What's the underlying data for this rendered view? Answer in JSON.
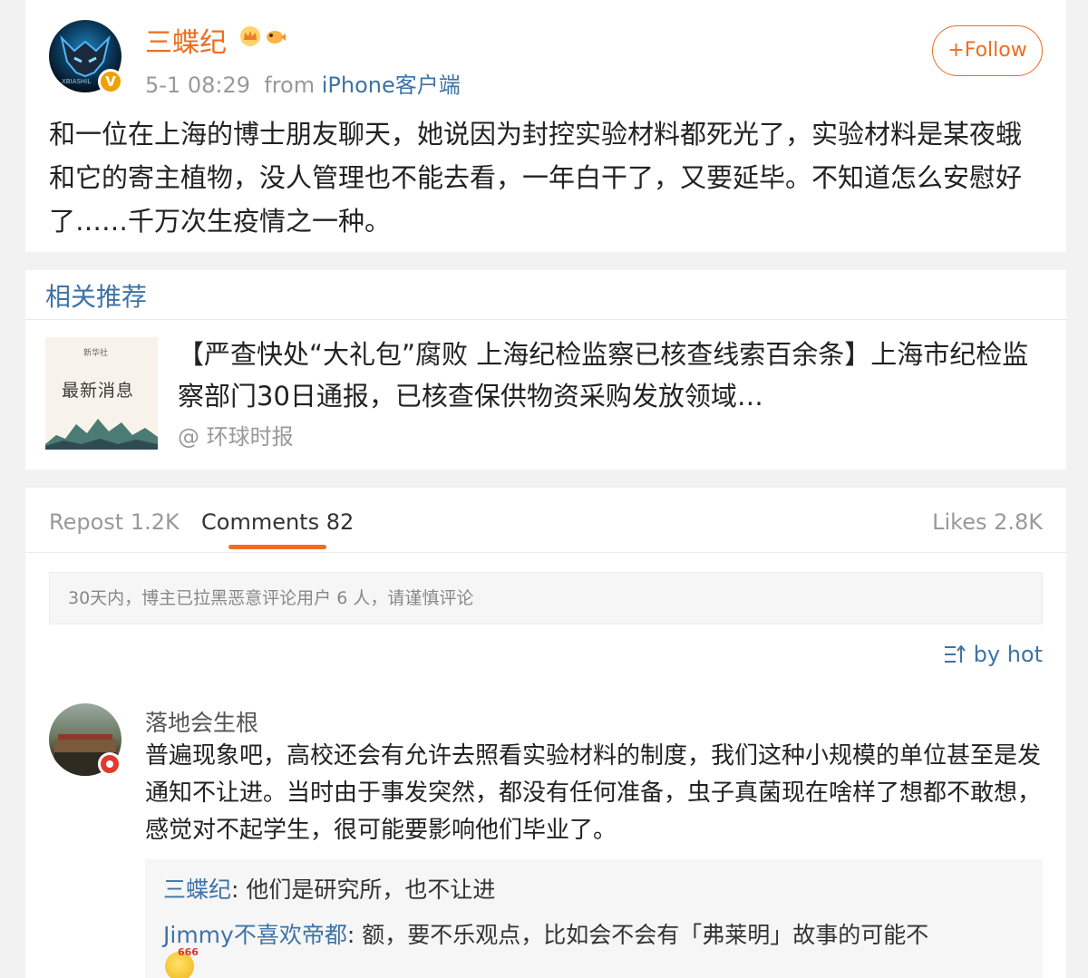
{
  "post": {
    "username": "三蝶纪",
    "avatar_text": "XBIASHIL",
    "verified_badge": "V",
    "timestamp": "5-1 08:29",
    "from_label": "from",
    "source": "iPhone客户端",
    "follow_label": "+Follow",
    "text": "和一位在上海的博士朋友聊天，她说因为封控实验材料都死光了，实验材料是某夜蛾和它的寄主植物，没人管理也不能去看，一年白干了，又要延毕。不知道怎么安慰好了……千万次生疫情之一种。"
  },
  "recommend": {
    "section_title": "相关推荐",
    "thumb_small": "新华社",
    "thumb_title": "最新消息",
    "text": "【严查快处“大礼包”腐败 上海纪检监察已核查线索百余条】上海市纪检监察部门30日通报，已核查保供物资采购发放领域…",
    "source": "@ 环球时报"
  },
  "tabs": {
    "repost": "Repost 1.2K",
    "comments": "Comments 82",
    "likes": "Likes 2.8K"
  },
  "notice": "30天内，博主已拉黑恶意评论用户 6 人，请谨慎评论",
  "sort_label": "by hot",
  "comment": {
    "user": "落地会生根",
    "text": "普遍现象吧，高校还会有允许去照看实验材料的制度，我们这种小规模的单位甚至是发通知不让进。当时由于事发突然，都没有任何准备，虫子真菌现在啥样了想都不敢想，感觉对不起学生，很可能要影响他们毕业了。",
    "replies": [
      {
        "user": "三蝶纪",
        "text": ": 他们是研究所，也不让进"
      },
      {
        "user": "Jimmy不喜欢帝都",
        "text": ": 额，要不乐观点，比如会不会有「弗莱明」故事的可能不"
      }
    ],
    "emoji_tag": "666"
  },
  "colors": {
    "accent": "#ee6d1e",
    "link": "#3e73a6",
    "muted": "#999999"
  },
  "icons": [
    "crown-badge-icon",
    "fish-badge-icon",
    "sort-icon",
    "heart-badge-icon",
    "emoji-666-icon"
  ]
}
